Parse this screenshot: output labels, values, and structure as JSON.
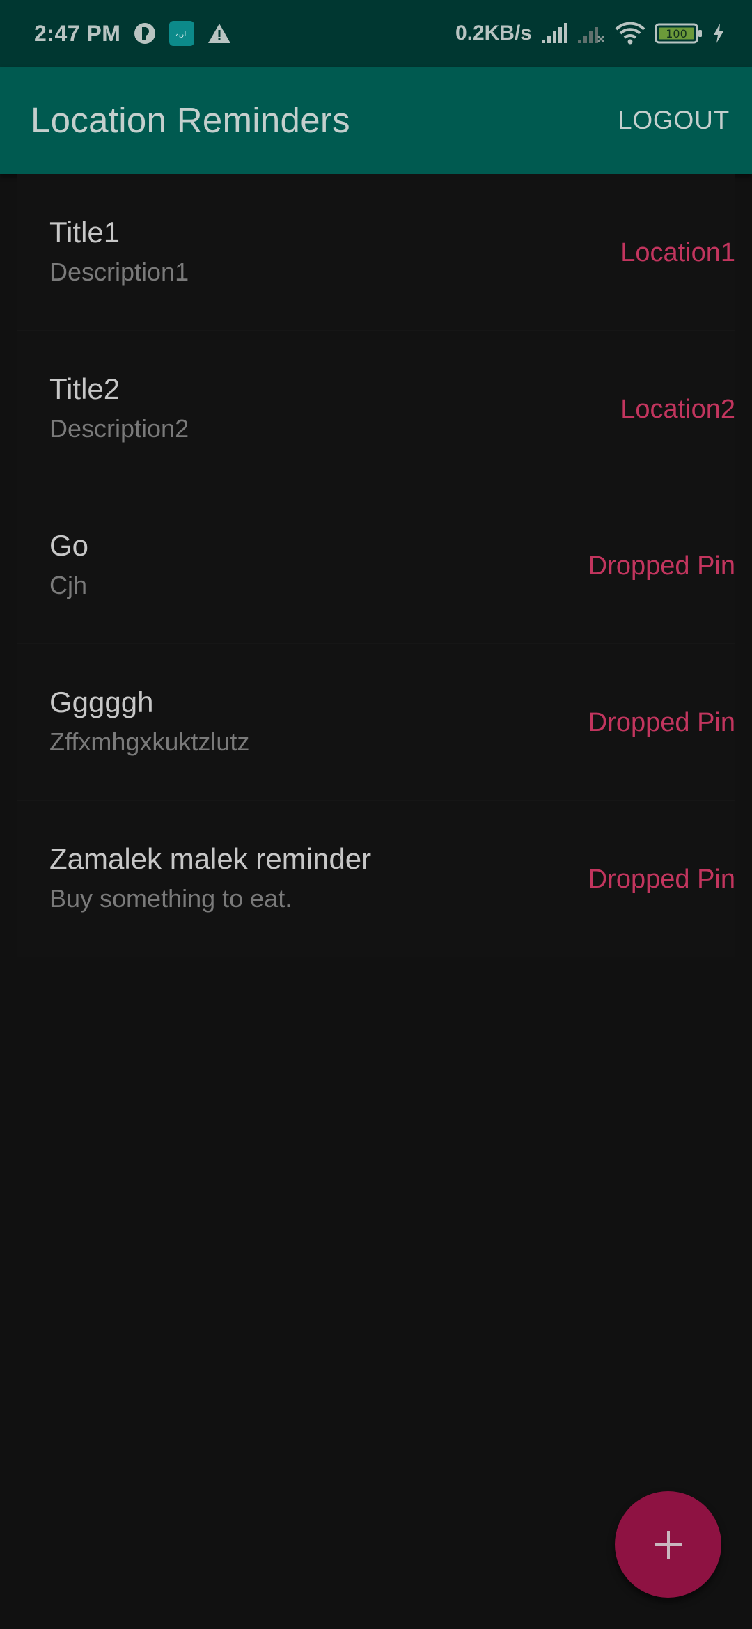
{
  "status_bar": {
    "time": "2:47 PM",
    "net_speed": "0.2KB/s",
    "battery_level": "100",
    "app_badge_text": "الرية"
  },
  "app_bar": {
    "title": "Location Reminders",
    "logout_label": "LOGOUT"
  },
  "reminders": [
    {
      "title": "Title1",
      "description": "Description1",
      "location": "Location1"
    },
    {
      "title": "Title2",
      "description": "Description2",
      "location": "Location2"
    },
    {
      "title": "Go",
      "description": "Cjh",
      "location": "Dropped Pin"
    },
    {
      "title": "Gggggh",
      "description": "Zffxmhgxkuktzlutz",
      "location": "Dropped Pin"
    },
    {
      "title": "Zamalek malek reminder",
      "description": "Buy something to eat.",
      "location": "Dropped Pin"
    }
  ],
  "fab": {
    "icon": "plus-icon"
  },
  "colors": {
    "status_bar_bg": "#003731",
    "app_bar_bg": "#005a50",
    "background": "#111111",
    "location_text": "#c2355e",
    "fab_bg": "#8e1242"
  }
}
